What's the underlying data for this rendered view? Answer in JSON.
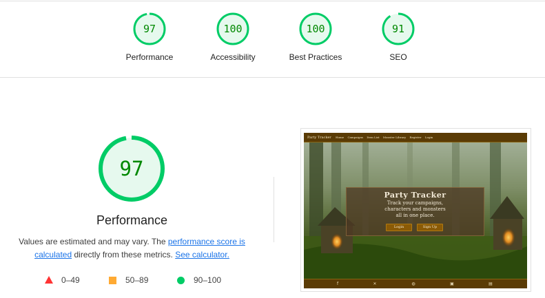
{
  "colors": {
    "pass": "#0c6",
    "pass_text": "#008800",
    "pass_fill": "#e6f9ee",
    "average": "#fa3",
    "fail": "#f33",
    "link": "#1a73e8"
  },
  "scores": [
    {
      "value": 97,
      "label": "Performance"
    },
    {
      "value": 100,
      "label": "Accessibility"
    },
    {
      "value": 100,
      "label": "Best Practices"
    },
    {
      "value": 91,
      "label": "SEO"
    }
  ],
  "main": {
    "score": 97,
    "title": "Performance",
    "desc_prefix": "Values are estimated and may vary. The ",
    "desc_link1": "performance score is calculated",
    "desc_mid": " directly from these metrics. ",
    "desc_link2": "See calculator."
  },
  "legend": [
    {
      "icon": "fail-triangle-icon",
      "range": "0–49"
    },
    {
      "icon": "average-square-icon",
      "range": "50–89"
    },
    {
      "icon": "pass-circle-icon",
      "range": "90–100"
    }
  ],
  "screenshot": {
    "nav": [
      "Party Tracker",
      "Home",
      "Campaigns",
      "Item List",
      "Monster Library",
      "Register",
      "Login"
    ],
    "hero_title": "Party Tracker",
    "hero_subtitle": "Track your campaigns, characters and monsters all in one place.",
    "login_button": "Login",
    "signup_button": "Sign Up",
    "footer_icons": [
      "facebook-icon",
      "x-icon",
      "discord-icon",
      "reddit-icon",
      "twitch-icon"
    ]
  }
}
